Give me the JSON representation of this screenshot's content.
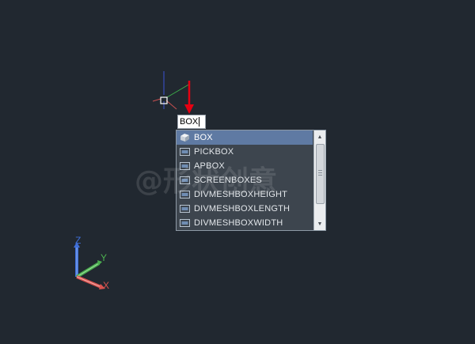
{
  "command_line": {
    "value": "BOX"
  },
  "autocomplete": {
    "items": [
      {
        "label": "BOX",
        "icon": "box-3d-icon",
        "selected": true
      },
      {
        "label": "PICKBOX",
        "icon": "system-variable-icon"
      },
      {
        "label": "APBOX",
        "icon": "system-variable-icon"
      },
      {
        "label": "SCREENBOXES",
        "icon": "system-variable-icon"
      },
      {
        "label": "DIVMESHBOXHEIGHT",
        "icon": "system-variable-icon"
      },
      {
        "label": "DIVMESHBOXLENGTH",
        "icon": "system-variable-icon"
      },
      {
        "label": "DIVMESHBOXWIDTH",
        "icon": "system-variable-icon"
      }
    ]
  },
  "ucs": {
    "x_label": "X",
    "y_label": "Y",
    "z_label": "Z"
  },
  "colors": {
    "background": "#212830",
    "selection": "#5f7aa3",
    "x_axis": "#d9534f",
    "y_axis": "#4caf50",
    "z_axis": "#3f6fd8",
    "arrow": "#e60012"
  },
  "watermark": {
    "text": "@形状创意"
  }
}
